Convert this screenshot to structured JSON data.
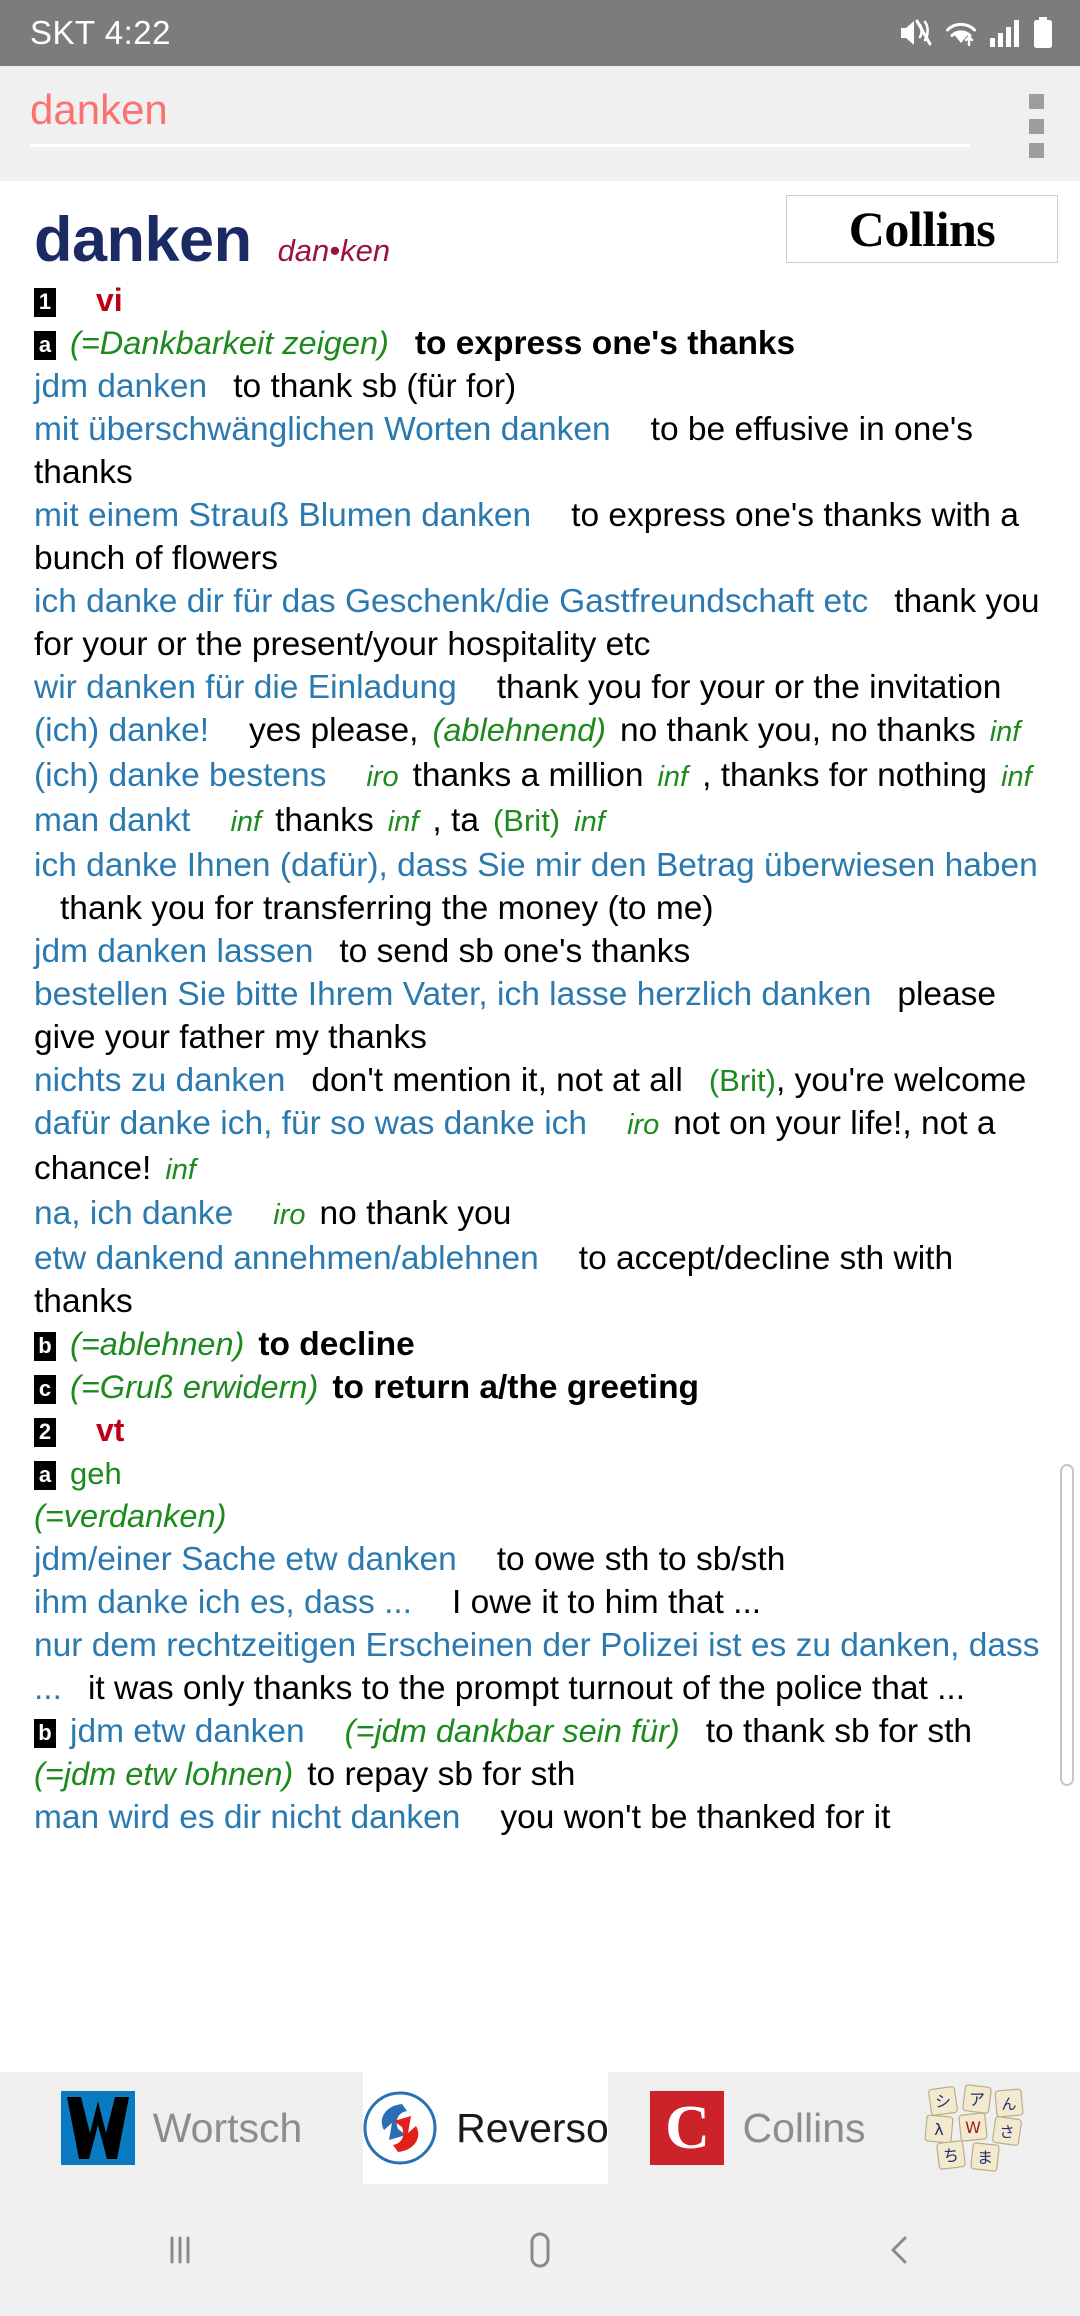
{
  "statusbar": {
    "carrier_time": "SKT 4:22",
    "icons": [
      "mute-icon",
      "wifi-icon",
      "signal-icon",
      "battery-icon"
    ]
  },
  "toolbar": {
    "search_value": "danken",
    "search_placeholder": "danken",
    "overflow_icon": "more-vertical-icon"
  },
  "content": {
    "source_badge": "Collins",
    "headword": "danken",
    "syllabification": "dan•ken",
    "entries": [
      {
        "id": "sense-1",
        "marker": "1",
        "pos": "vi"
      },
      {
        "id": "sense-1a",
        "marker": "a",
        "gloss": "(=Dankbarkeit zeigen)",
        "translation": "to express one's thanks"
      },
      {
        "id": "ex-1",
        "de": "jdm danken",
        "en": "to thank sb (für for)"
      },
      {
        "id": "ex-2",
        "de": "mit überschwänglichen Worten danken",
        "en": "to be effusive in one's thanks"
      },
      {
        "id": "ex-3",
        "de": "mit einem Strauß Blumen danken",
        "en": "to express one's thanks with a bunch of flowers"
      },
      {
        "id": "ex-4",
        "de": "ich danke dir für das Geschenk/die Gastfreundschaft etc",
        "en": "thank you for your or the present/your hospitality etc"
      },
      {
        "id": "ex-5",
        "de": "wir danken für die Einladung",
        "en": "thank you for your or the invitation"
      },
      {
        "id": "ex-6",
        "de": "(ich) danke!",
        "en_a": "yes please,",
        "gloss": "(ablehnend)",
        "en_b": "no thank you, no thanks",
        "label": "inf"
      },
      {
        "id": "ex-7",
        "de": "(ich) danke bestens",
        "label1": "iro",
        "en_a": "thanks a million",
        "label2": "inf",
        "en_b": ", thanks for nothing",
        "label3": "inf"
      },
      {
        "id": "ex-8",
        "de": "man dankt",
        "label1": "inf",
        "en_a": "thanks",
        "label2": "inf",
        "en_b": ", ta",
        "reg": "(Brit)",
        "label3": "inf"
      },
      {
        "id": "ex-9",
        "de": "ich danke Ihnen (dafür), dass Sie mir den Betrag überwiesen haben",
        "en": "thank you for transferring the money (to me)"
      },
      {
        "id": "ex-10",
        "de": "jdm danken lassen",
        "en": "to send sb one's thanks"
      },
      {
        "id": "ex-11",
        "de": "bestellen Sie bitte Ihrem Vater, ich lasse herzlich danken",
        "en": "please give your father my thanks"
      },
      {
        "id": "ex-12",
        "de": "nichts zu danken",
        "en_a": "don't mention it, not at all",
        "reg": "(Brit)",
        "en_b": ", you're welcome"
      },
      {
        "id": "ex-13",
        "de": "dafür danke ich, für so was danke ich",
        "label1": "iro",
        "en_a": "not on your life!, not a chance!",
        "label2": "inf"
      },
      {
        "id": "ex-14",
        "de": "na, ich danke",
        "label1": "iro",
        "en_a": "no thank you"
      },
      {
        "id": "ex-15",
        "de": "etw dankend annehmen/ablehnen",
        "en": "to accept/decline sth with thanks"
      },
      {
        "id": "sense-1b",
        "marker": "b",
        "gloss": "(=ablehnen)",
        "translation": "to decline"
      },
      {
        "id": "sense-1c",
        "marker": "c",
        "gloss": "(=Gruß erwidern)",
        "translation": "to return a/the greeting"
      },
      {
        "id": "sense-2",
        "marker": "2",
        "pos": "vt"
      },
      {
        "id": "sense-2a",
        "marker": "a",
        "reg": "geh",
        "gloss": "(=verdanken)"
      },
      {
        "id": "ex-16",
        "de": "jdm/einer Sache etw danken",
        "en": "to owe sth to sb/sth"
      },
      {
        "id": "ex-17",
        "de": "ihm danke ich es, dass ...",
        "en": "I owe it to him that ..."
      },
      {
        "id": "ex-18",
        "de": "nur dem rechtzeitigen Erscheinen der Polizei ist es zu danken, dass ...",
        "en": "it was only thanks to the prompt turnout of the police that ..."
      },
      {
        "id": "sense-2b",
        "marker": "b",
        "de": "jdm etw danken",
        "gloss1": "(=jdm dankbar sein für)",
        "en_a": "to thank sb for sth",
        "gloss2": "(=jdm etw lohnen)",
        "en_b": "to repay sb for sth"
      },
      {
        "id": "ex-19",
        "de": "man wird es dir nicht danken",
        "en": "you won't be thanked for it"
      }
    ]
  },
  "tabs": [
    {
      "id": "tab-wortsch",
      "label": "Wortsch",
      "icon": "wortschatz-logo-icon",
      "active": false
    },
    {
      "id": "tab-reverso",
      "label": "Reverso",
      "icon": "reverso-logo-icon",
      "active": true
    },
    {
      "id": "tab-collins",
      "label": "Collins",
      "icon": "collins-logo-icon",
      "active": false
    },
    {
      "id": "tab-kanji",
      "label": "",
      "icon": "kanji-tiles-logo-icon",
      "active": false
    }
  ],
  "navbar": {
    "recents_label": "recents-icon",
    "home_label": "home-icon",
    "back_label": "back-icon"
  },
  "colors": {
    "statusbar_bg": "#7c7c7c",
    "toolbar_bg": "#f0f0f0",
    "search_text": "#fb7272",
    "headword": "#1b2a63",
    "syllable": "#9c1244",
    "german": "#2a7ab0",
    "gloss_green": "#1d8a1d",
    "pos_red": "#bb0018",
    "collins_red": "#cc2229",
    "wortschatz_blue": "#0b7bc1"
  }
}
